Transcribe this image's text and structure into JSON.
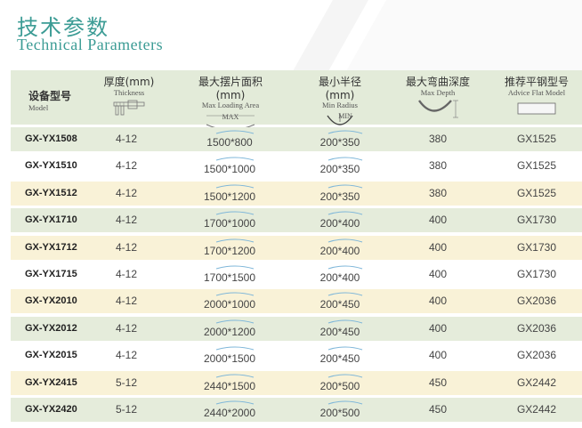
{
  "title": {
    "cn": "技术参数",
    "en": "Technical Parameters"
  },
  "header": {
    "model": {
      "cn": "设备型号",
      "en": "Model"
    },
    "thickness": {
      "cn": "厚度(mm)",
      "en": "Thickness"
    },
    "area": {
      "cn": "最大摆片面积(mm)",
      "en": "Max Loading Area",
      "icon_label": "MAX"
    },
    "radius": {
      "cn": "最小半径(mm)",
      "en": "Min Radius",
      "icon_label": "MIN"
    },
    "depth": {
      "cn": "最大弯曲深度",
      "en": "Max Depth"
    },
    "flat": {
      "cn": "推荐平钢型号",
      "en": "Advice Flat Model"
    }
  },
  "rows": [
    {
      "model": "GX-YX1508",
      "thickness": "4-12",
      "area": "1500*800",
      "radius": "200*350",
      "depth": "380",
      "flat": "GX1525",
      "band": "g"
    },
    {
      "model": "GX-YX1510",
      "thickness": "4-12",
      "area": "1500*1000",
      "radius": "200*350",
      "depth": "380",
      "flat": "GX1525",
      "band": "w"
    },
    {
      "model": "GX-YX1512",
      "thickness": "4-12",
      "area": "1500*1200",
      "radius": "200*350",
      "depth": "380",
      "flat": "GX1525",
      "band": "y"
    },
    {
      "model": "GX-YX1710",
      "thickness": "4-12",
      "area": "1700*1000",
      "radius": "200*400",
      "depth": "400",
      "flat": "GX1730",
      "band": "g"
    },
    {
      "model": "GX-YX1712",
      "thickness": "4-12",
      "area": "1700*1200",
      "radius": "200*400",
      "depth": "400",
      "flat": "GX1730",
      "band": "y"
    },
    {
      "model": "GX-YX1715",
      "thickness": "4-12",
      "area": "1700*1500",
      "radius": "200*400",
      "depth": "400",
      "flat": "GX1730",
      "band": "w"
    },
    {
      "model": "GX-YX2010",
      "thickness": "4-12",
      "area": "2000*1000",
      "radius": "200*450",
      "depth": "400",
      "flat": "GX2036",
      "band": "y"
    },
    {
      "model": "GX-YX2012",
      "thickness": "4-12",
      "area": "2000*1200",
      "radius": "200*450",
      "depth": "400",
      "flat": "GX2036",
      "band": "g"
    },
    {
      "model": "GX-YX2015",
      "thickness": "4-12",
      "area": "2000*1500",
      "radius": "200*450",
      "depth": "400",
      "flat": "GX2036",
      "band": "w"
    },
    {
      "model": "GX-YX2415",
      "thickness": "5-12",
      "area": "2440*1500",
      "radius": "200*500",
      "depth": "450",
      "flat": "GX2442",
      "band": "y"
    },
    {
      "model": "GX-YX2420",
      "thickness": "5-12",
      "area": "2440*2000",
      "radius": "200*500",
      "depth": "450",
      "flat": "GX2442",
      "band": "g"
    }
  ],
  "colors": {
    "accent": "#3c9c95",
    "band_green": "#e5ecdb",
    "band_yellow": "#f9f2d7",
    "arc": "#7fb7d9"
  }
}
